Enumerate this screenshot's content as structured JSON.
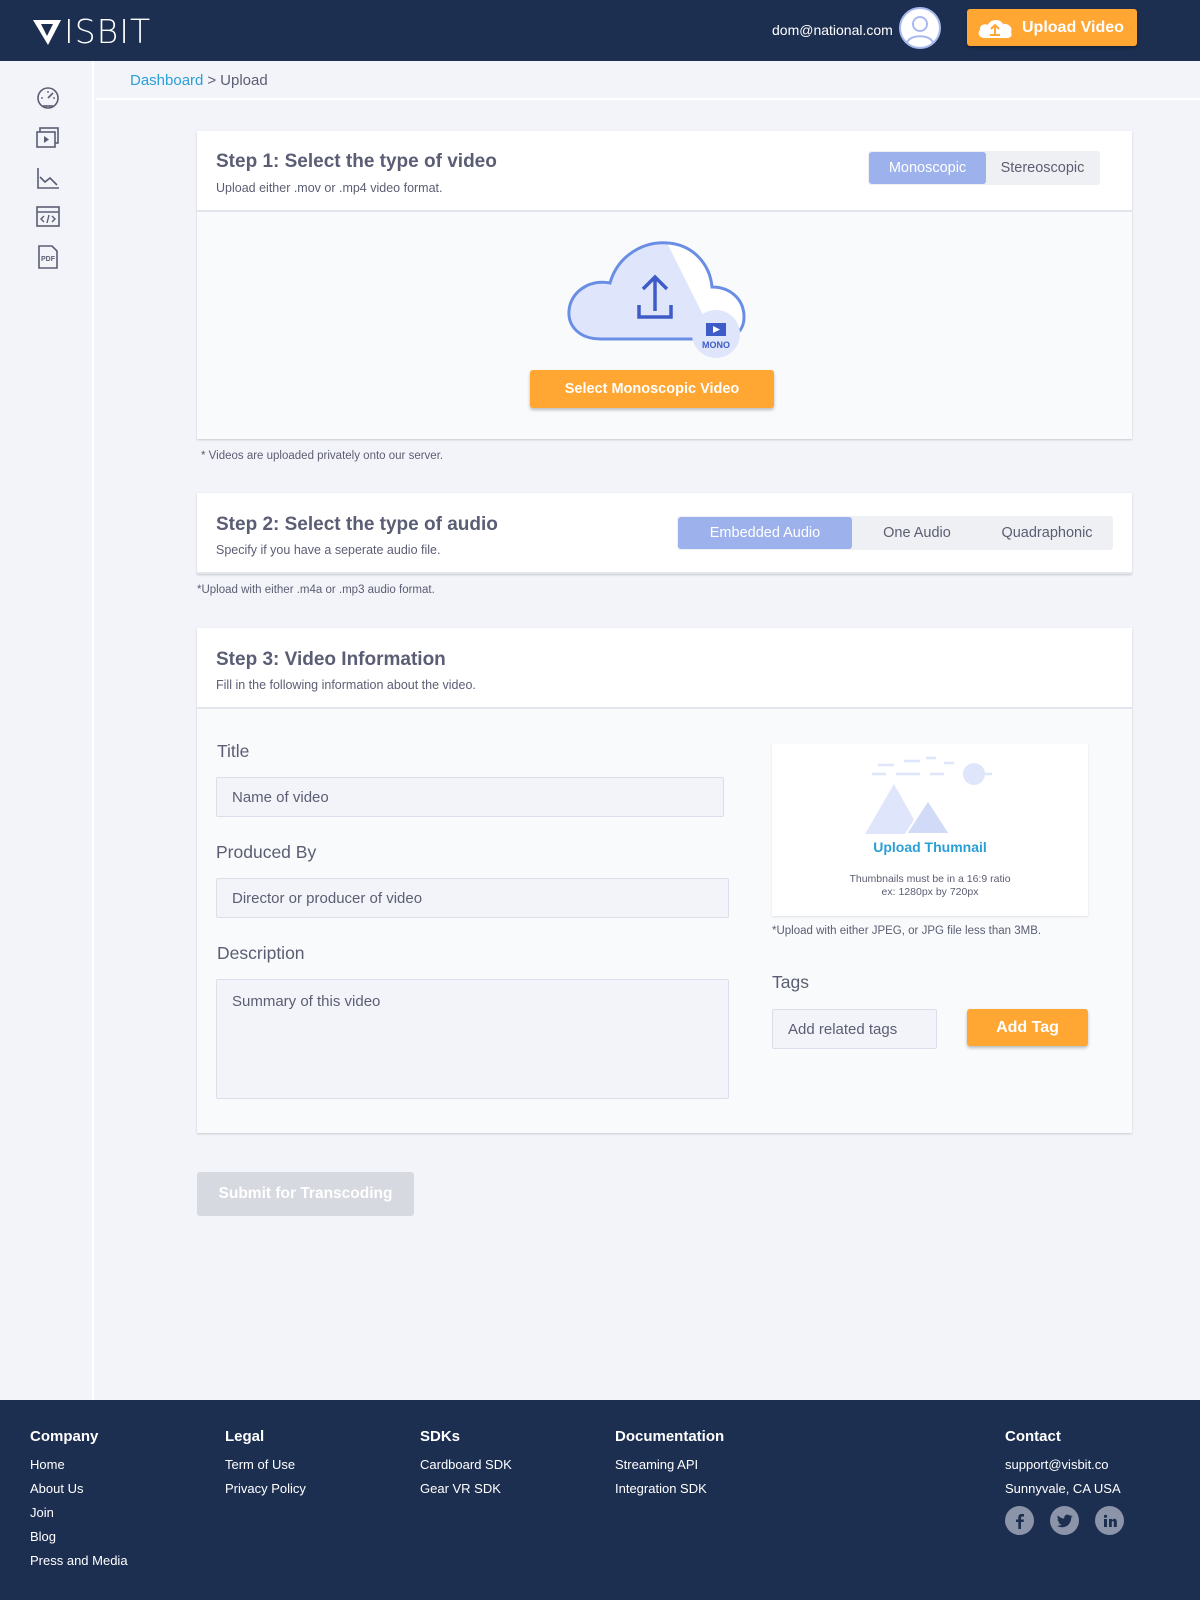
{
  "header": {
    "logo_text": "ISBIT",
    "logo_alt": "VISBIT",
    "user_email": "dom@national.com",
    "upload_button": "Upload Video"
  },
  "sidebar": {
    "items": [
      {
        "icon": "dashboard-gauge-icon"
      },
      {
        "icon": "video-library-icon"
      },
      {
        "icon": "analytics-chart-icon"
      },
      {
        "icon": "code-embed-icon"
      },
      {
        "icon": "pdf-document-icon",
        "label": "PDF"
      }
    ]
  },
  "breadcrumb": {
    "link": "Dashboard",
    "separator": ">",
    "current": "Upload"
  },
  "step1": {
    "title": "Step 1:  Select the type of video",
    "subtitle": "Upload either .mov or .mp4 video format.",
    "options": [
      "Monoscopic",
      "Stereoscopic"
    ],
    "selected": "Monoscopic",
    "badge": "MONO",
    "select_button": "Select Monoscopic Video",
    "note": "* Videos are uploaded privately onto our server."
  },
  "step2": {
    "title": "Step 2: Select the type of audio",
    "subtitle": "Specify if you have a seperate audio file.",
    "options": [
      "Embedded Audio",
      "One Audio",
      "Quadraphonic"
    ],
    "selected": "Embedded Audio",
    "note": "*Upload with either .m4a or .mp3 audio format."
  },
  "step3": {
    "title": "Step 3:  Video Information",
    "subtitle": "Fill in the following information about the video.",
    "title_label": "Title",
    "title_placeholder": "Name of video",
    "produced_label": "Produced By",
    "produced_placeholder": "Director or producer of video",
    "description_label": "Description",
    "description_placeholder": "Summary of this video",
    "thumbnail_link": "Upload Thumnail",
    "thumbnail_hint1": "Thumbnails must be in a 16:9 ratio",
    "thumbnail_hint2": "ex: 1280px by 720px",
    "thumbnail_note": "*Upload with either JPEG, or JPG file less than 3MB.",
    "tags_label": "Tags",
    "tags_placeholder": "Add related tags",
    "add_tag_button": "Add Tag"
  },
  "submit_button": "Submit for Transcoding",
  "footer": {
    "company": {
      "heading": "Company",
      "links": [
        "Home",
        "About Us",
        "Join",
        "Blog",
        "Press and Media"
      ]
    },
    "legal": {
      "heading": "Legal",
      "links": [
        "Term of Use",
        "Privacy Policy"
      ]
    },
    "sdks": {
      "heading": "SDKs",
      "links": [
        "Cardboard SDK",
        "Gear VR SDK"
      ]
    },
    "documentation": {
      "heading": "Documentation",
      "links": [
        "Streaming API",
        "Integration SDK"
      ]
    },
    "contact": {
      "heading": "Contact",
      "links": [
        "support@visbit.co",
        "Sunnyvale, CA USA"
      ]
    },
    "social": [
      "facebook-icon",
      "twitter-icon",
      "linkedin-icon"
    ]
  },
  "colors": {
    "navy": "#1d2f50",
    "orange": "#ffa633",
    "link_blue": "#2a9fd6",
    "active_segment": "#9db2ec",
    "illustration_blue": "#6b8ee5"
  }
}
